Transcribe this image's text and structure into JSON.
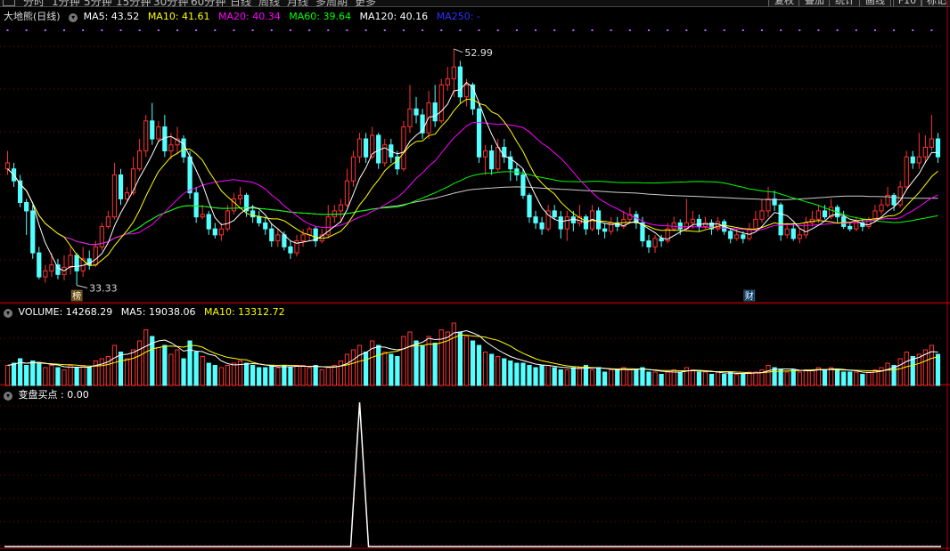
{
  "toolbar": {
    "items": [
      "分时",
      "1分钟",
      "5分钟",
      "15分钟",
      "30分钟",
      "60分钟",
      "日线",
      "周线",
      "月线",
      "多周期",
      "更多"
    ],
    "buttons": [
      "复权",
      "叠加",
      "统计",
      "画线",
      "F10",
      "标记"
    ]
  },
  "price_panel": {
    "title": "大地熊(日线)",
    "indicators": [
      {
        "label": "MA5: 43.52",
        "color": "#ffffff"
      },
      {
        "label": "MA10: 41.61",
        "color": "#ffff00"
      },
      {
        "label": "MA20: 40.34",
        "color": "#ff00ff"
      },
      {
        "label": "MA60: 39.64",
        "color": "#00ff00"
      },
      {
        "label": "MA120: 40.16",
        "color": "#ffffff"
      },
      {
        "label": "MA250: -",
        "color": "#3030ff"
      }
    ],
    "high_label": "52.99",
    "low_label": "33.33",
    "markers": [
      {
        "text": "榜",
        "index": 11
      },
      {
        "text": "财",
        "index": 118
      }
    ]
  },
  "volume_panel": {
    "indicators": [
      {
        "label": "VOLUME: 14268.29",
        "color": "#ffffff"
      },
      {
        "label": "MA5: 19038.06",
        "color": "#ffffff"
      },
      {
        "label": "MA10: 13312.72",
        "color": "#ffff00"
      }
    ]
  },
  "signal_panel": {
    "indicators": [
      {
        "label": "变盘买点 : 0.00",
        "color": "#ffffff"
      }
    ]
  },
  "colors": {
    "up": "#ff3232",
    "down": "#54ffff",
    "grid": "#8a0000",
    "ma5": "#ffffff",
    "ma10": "#ffff00",
    "ma20": "#ff00ff",
    "ma60": "#00ff00",
    "ma120": "#cccccc",
    "signal": "#ffffff"
  },
  "chart_data": {
    "type": "candlestick",
    "price_range": [
      32,
      55
    ],
    "volume_range": [
      0,
      30000
    ],
    "signal_range": [
      0,
      1
    ],
    "candles": [
      [
        43.5,
        43.0,
        44.5,
        42.5,
        9000,
        "u"
      ],
      [
        43.0,
        42.0,
        43.5,
        41.5,
        10000,
        "d"
      ],
      [
        42.0,
        40.2,
        42.5,
        39.8,
        12000,
        "d"
      ],
      [
        40.2,
        39.5,
        40.5,
        37.5,
        9000,
        "d"
      ],
      [
        39.5,
        36.0,
        40.0,
        35.5,
        11000,
        "d"
      ],
      [
        36.0,
        34.0,
        36.5,
        33.8,
        10000,
        "d"
      ],
      [
        34.0,
        34.5,
        35.0,
        33.5,
        8000,
        "u"
      ],
      [
        34.5,
        35.0,
        36.0,
        34.0,
        9000,
        "u"
      ],
      [
        35.0,
        34.2,
        35.5,
        33.8,
        8000,
        "d"
      ],
      [
        34.2,
        34.8,
        35.8,
        33.7,
        7000,
        "u"
      ],
      [
        34.8,
        35.8,
        36.5,
        34.2,
        9000,
        "u"
      ],
      [
        35.8,
        34.5,
        36.0,
        33.3,
        8000,
        "d"
      ],
      [
        34.5,
        35.5,
        36.5,
        34.0,
        9000,
        "u"
      ],
      [
        35.5,
        35.0,
        36.2,
        34.6,
        8000,
        "d"
      ],
      [
        35.0,
        36.5,
        37.0,
        34.8,
        11000,
        "u"
      ],
      [
        36.5,
        38.2,
        38.5,
        36.2,
        12000,
        "u"
      ],
      [
        38.2,
        39.0,
        39.5,
        38.0,
        13000,
        "u"
      ],
      [
        39.0,
        42.5,
        43.5,
        38.8,
        18000,
        "u"
      ],
      [
        42.5,
        40.5,
        43.0,
        40.0,
        15000,
        "d"
      ],
      [
        40.5,
        41.0,
        41.5,
        40.2,
        12000,
        "u"
      ],
      [
        41.0,
        43.0,
        44.0,
        40.8,
        16000,
        "u"
      ],
      [
        43.0,
        44.5,
        45.5,
        42.8,
        20000,
        "u"
      ],
      [
        44.5,
        47.0,
        47.5,
        44.0,
        25000,
        "u"
      ],
      [
        47.0,
        45.5,
        48.5,
        45.0,
        22000,
        "d"
      ],
      [
        45.5,
        46.5,
        47.0,
        45.2,
        17000,
        "u"
      ],
      [
        46.5,
        44.5,
        47.5,
        44.0,
        18000,
        "d"
      ],
      [
        44.5,
        45.0,
        46.0,
        43.8,
        14000,
        "u"
      ],
      [
        45.0,
        45.5,
        46.5,
        44.2,
        16000,
        "u"
      ],
      [
        45.5,
        44.0,
        45.8,
        43.5,
        12000,
        "d"
      ],
      [
        44.0,
        41.0,
        44.5,
        40.5,
        20000,
        "d"
      ],
      [
        41.0,
        39.0,
        41.5,
        38.5,
        15000,
        "d"
      ],
      [
        39.0,
        39.2,
        40.0,
        38.8,
        13000,
        "u"
      ],
      [
        39.2,
        38.0,
        39.5,
        37.5,
        10000,
        "d"
      ],
      [
        38.0,
        37.5,
        38.5,
        37.2,
        9000,
        "d"
      ],
      [
        37.5,
        38.0,
        38.5,
        37.0,
        8000,
        "u"
      ],
      [
        38.0,
        39.5,
        40.0,
        37.8,
        9000,
        "u"
      ],
      [
        39.5,
        40.5,
        41.0,
        39.2,
        10000,
        "u"
      ],
      [
        40.5,
        40.8,
        41.5,
        40.0,
        11000,
        "u"
      ],
      [
        40.8,
        39.5,
        41.0,
        39.0,
        10000,
        "d"
      ],
      [
        39.5,
        39.0,
        40.0,
        38.5,
        9000,
        "d"
      ],
      [
        39.0,
        38.5,
        39.5,
        38.2,
        8000,
        "d"
      ],
      [
        38.5,
        38.0,
        39.0,
        37.5,
        8000,
        "d"
      ],
      [
        38.0,
        37.0,
        38.5,
        36.5,
        9000,
        "d"
      ],
      [
        37.0,
        37.5,
        38.0,
        36.5,
        8000,
        "u"
      ],
      [
        37.5,
        36.5,
        37.8,
        36.2,
        9000,
        "d"
      ],
      [
        36.5,
        36.0,
        37.0,
        35.5,
        8000,
        "d"
      ],
      [
        36.0,
        37.0,
        37.5,
        35.7,
        9000,
        "u"
      ],
      [
        37.0,
        37.5,
        38.0,
        36.5,
        9000,
        "u"
      ],
      [
        37.5,
        38.0,
        38.2,
        37.0,
        8000,
        "u"
      ],
      [
        38.0,
        37.0,
        38.2,
        36.5,
        9000,
        "d"
      ],
      [
        37.0,
        37.5,
        38.0,
        36.8,
        7000,
        "u"
      ],
      [
        37.5,
        39.0,
        40.0,
        37.2,
        8000,
        "u"
      ],
      [
        39.0,
        39.5,
        40.0,
        38.5,
        9000,
        "u"
      ],
      [
        39.5,
        40.0,
        40.5,
        38.5,
        11000,
        "u"
      ],
      [
        40.0,
        42.0,
        43.0,
        39.8,
        14000,
        "u"
      ],
      [
        42.0,
        44.0,
        44.5,
        41.5,
        16000,
        "u"
      ],
      [
        44.0,
        45.5,
        46.0,
        43.5,
        18000,
        "u"
      ],
      [
        45.5,
        44.0,
        46.0,
        43.5,
        15000,
        "d"
      ],
      [
        44.0,
        45.8,
        46.5,
        43.8,
        20000,
        "u"
      ],
      [
        45.8,
        43.5,
        46.0,
        43.0,
        18000,
        "d"
      ],
      [
        43.5,
        45.0,
        45.5,
        43.2,
        15000,
        "u"
      ],
      [
        45.0,
        44.0,
        45.5,
        43.5,
        14000,
        "d"
      ],
      [
        44.0,
        43.0,
        44.5,
        42.5,
        13000,
        "d"
      ],
      [
        43.0,
        46.5,
        47.0,
        42.8,
        22000,
        "u"
      ],
      [
        46.5,
        48.0,
        50.0,
        46.0,
        24000,
        "u"
      ],
      [
        48.0,
        47.5,
        49.0,
        46.8,
        20000,
        "d"
      ],
      [
        47.5,
        46.0,
        48.0,
        45.5,
        18000,
        "d"
      ],
      [
        46.0,
        48.5,
        49.5,
        45.5,
        22000,
        "u"
      ],
      [
        48.5,
        47.0,
        50.0,
        46.5,
        19000,
        "d"
      ],
      [
        47.0,
        50.0,
        50.5,
        46.8,
        25000,
        "u"
      ],
      [
        50.0,
        50.5,
        51.5,
        49.5,
        24000,
        "u"
      ],
      [
        50.5,
        51.5,
        53.0,
        49.0,
        28000,
        "u"
      ],
      [
        51.5,
        49.0,
        52.0,
        48.5,
        24000,
        "d"
      ],
      [
        49.0,
        50.0,
        50.5,
        48.2,
        22000,
        "u"
      ],
      [
        50.0,
        48.0,
        50.2,
        47.5,
        20000,
        "d"
      ],
      [
        48.0,
        44.0,
        48.5,
        43.5,
        18000,
        "d"
      ],
      [
        44.0,
        44.5,
        45.0,
        42.5,
        15000,
        "u"
      ],
      [
        44.5,
        43.0,
        45.0,
        42.5,
        14000,
        "d"
      ],
      [
        43.0,
        44.8,
        45.5,
        42.8,
        13000,
        "u"
      ],
      [
        44.8,
        44.0,
        45.5,
        43.5,
        12000,
        "d"
      ],
      [
        44.0,
        43.0,
        44.5,
        42.0,
        11000,
        "d"
      ],
      [
        43.0,
        42.5,
        43.5,
        42.0,
        10000,
        "d"
      ],
      [
        42.5,
        40.8,
        43.0,
        40.5,
        10000,
        "d"
      ],
      [
        40.8,
        39.0,
        41.0,
        38.5,
        9000,
        "d"
      ],
      [
        39.0,
        38.5,
        39.5,
        38.0,
        8000,
        "d"
      ],
      [
        38.5,
        38.0,
        39.0,
        37.5,
        9000,
        "d"
      ],
      [
        38.0,
        39.5,
        40.0,
        37.8,
        9000,
        "u"
      ],
      [
        39.5,
        39.0,
        40.0,
        38.8,
        8000,
        "d"
      ],
      [
        39.0,
        38.0,
        39.5,
        37.2,
        7000,
        "d"
      ],
      [
        38.0,
        39.0,
        39.5,
        37.0,
        7000,
        "u"
      ],
      [
        39.0,
        38.5,
        39.5,
        37.8,
        8000,
        "d"
      ],
      [
        38.5,
        39.0,
        40.0,
        38.2,
        8000,
        "u"
      ],
      [
        39.0,
        38.0,
        39.2,
        37.5,
        9000,
        "d"
      ],
      [
        38.0,
        39.5,
        40.0,
        37.8,
        7000,
        "u"
      ],
      [
        39.5,
        38.0,
        39.8,
        37.5,
        8000,
        "d"
      ],
      [
        38.0,
        37.8,
        38.5,
        37.2,
        6000,
        "d"
      ],
      [
        37.8,
        38.5,
        39.0,
        37.5,
        7000,
        "u"
      ],
      [
        38.5,
        38.2,
        39.0,
        37.8,
        7000,
        "d"
      ],
      [
        38.2,
        38.8,
        39.5,
        38.0,
        8000,
        "u"
      ],
      [
        38.8,
        39.2,
        39.8,
        38.5,
        7000,
        "u"
      ],
      [
        39.2,
        38.5,
        39.5,
        38.0,
        7000,
        "d"
      ],
      [
        38.5,
        37.0,
        39.0,
        36.5,
        8000,
        "d"
      ],
      [
        37.0,
        36.5,
        37.5,
        36.0,
        6000,
        "d"
      ],
      [
        36.5,
        37.2,
        37.5,
        36.0,
        6000,
        "u"
      ],
      [
        37.2,
        37.0,
        37.5,
        36.5,
        5000,
        "d"
      ],
      [
        37.0,
        38.0,
        38.5,
        36.8,
        6000,
        "u"
      ],
      [
        38.0,
        38.5,
        39.0,
        37.8,
        7000,
        "u"
      ],
      [
        38.5,
        38.0,
        38.8,
        37.5,
        6000,
        "d"
      ],
      [
        38.0,
        38.5,
        40.5,
        37.8,
        8000,
        "u"
      ],
      [
        38.5,
        38.8,
        39.5,
        38.0,
        7000,
        "u"
      ],
      [
        38.8,
        38.2,
        39.2,
        37.8,
        6000,
        "d"
      ],
      [
        38.2,
        38.5,
        39.0,
        38.0,
        6000,
        "u"
      ],
      [
        38.5,
        38.0,
        38.8,
        37.5,
        5000,
        "d"
      ],
      [
        38.0,
        38.6,
        39.0,
        37.8,
        6000,
        "u"
      ],
      [
        38.6,
        37.8,
        38.8,
        37.5,
        5000,
        "d"
      ],
      [
        37.8,
        37.2,
        38.0,
        36.8,
        6000,
        "d"
      ],
      [
        37.2,
        37.5,
        38.0,
        37.0,
        5000,
        "u"
      ],
      [
        37.5,
        37.2,
        37.8,
        36.8,
        5000,
        "d"
      ],
      [
        37.2,
        38.0,
        38.5,
        37.0,
        6000,
        "u"
      ],
      [
        38.0,
        38.8,
        39.5,
        37.8,
        6000,
        "u"
      ],
      [
        38.8,
        39.5,
        40.5,
        38.5,
        7000,
        "u"
      ],
      [
        39.5,
        40.5,
        41.5,
        39.0,
        9000,
        "u"
      ],
      [
        40.5,
        40.0,
        41.2,
        39.5,
        8000,
        "d"
      ],
      [
        40.0,
        37.5,
        40.2,
        37.0,
        7000,
        "d"
      ],
      [
        37.5,
        38.0,
        38.5,
        37.2,
        6000,
        "u"
      ],
      [
        38.0,
        37.2,
        38.5,
        37.0,
        7000,
        "d"
      ],
      [
        37.2,
        37.5,
        38.0,
        36.8,
        6000,
        "u"
      ],
      [
        37.5,
        38.5,
        39.0,
        37.2,
        7000,
        "u"
      ],
      [
        38.5,
        38.8,
        39.5,
        38.2,
        7000,
        "u"
      ],
      [
        38.8,
        39.5,
        40.0,
        38.5,
        8000,
        "u"
      ],
      [
        39.5,
        39.0,
        40.0,
        38.8,
        7000,
        "d"
      ],
      [
        39.0,
        39.8,
        40.5,
        38.8,
        8000,
        "u"
      ],
      [
        39.8,
        39.0,
        40.0,
        38.5,
        7000,
        "d"
      ],
      [
        39.0,
        38.2,
        39.5,
        38.0,
        6000,
        "d"
      ],
      [
        38.2,
        38.0,
        38.5,
        37.8,
        6000,
        "d"
      ],
      [
        38.0,
        38.5,
        39.0,
        37.8,
        6000,
        "u"
      ],
      [
        38.5,
        38.2,
        38.8,
        37.8,
        5000,
        "d"
      ],
      [
        38.2,
        38.8,
        39.0,
        38.0,
        6000,
        "u"
      ],
      [
        38.8,
        39.5,
        40.0,
        38.5,
        7000,
        "u"
      ],
      [
        39.5,
        40.0,
        40.5,
        39.2,
        8000,
        "u"
      ],
      [
        40.0,
        40.8,
        41.5,
        39.8,
        10000,
        "u"
      ],
      [
        40.8,
        40.0,
        41.0,
        39.5,
        9000,
        "d"
      ],
      [
        40.0,
        41.5,
        42.0,
        39.8,
        12000,
        "u"
      ],
      [
        41.5,
        44.0,
        44.5,
        41.2,
        15000,
        "u"
      ],
      [
        44.0,
        43.5,
        44.5,
        43.0,
        13000,
        "d"
      ],
      [
        43.5,
        44.0,
        46.0,
        43.0,
        14000,
        "u"
      ],
      [
        44.0,
        44.8,
        45.8,
        43.5,
        16000,
        "u"
      ],
      [
        44.8,
        45.5,
        47.5,
        44.5,
        18000,
        "u"
      ],
      [
        45.5,
        44.0,
        46.0,
        43.5,
        14000,
        "d"
      ]
    ],
    "signal_index": 56
  }
}
